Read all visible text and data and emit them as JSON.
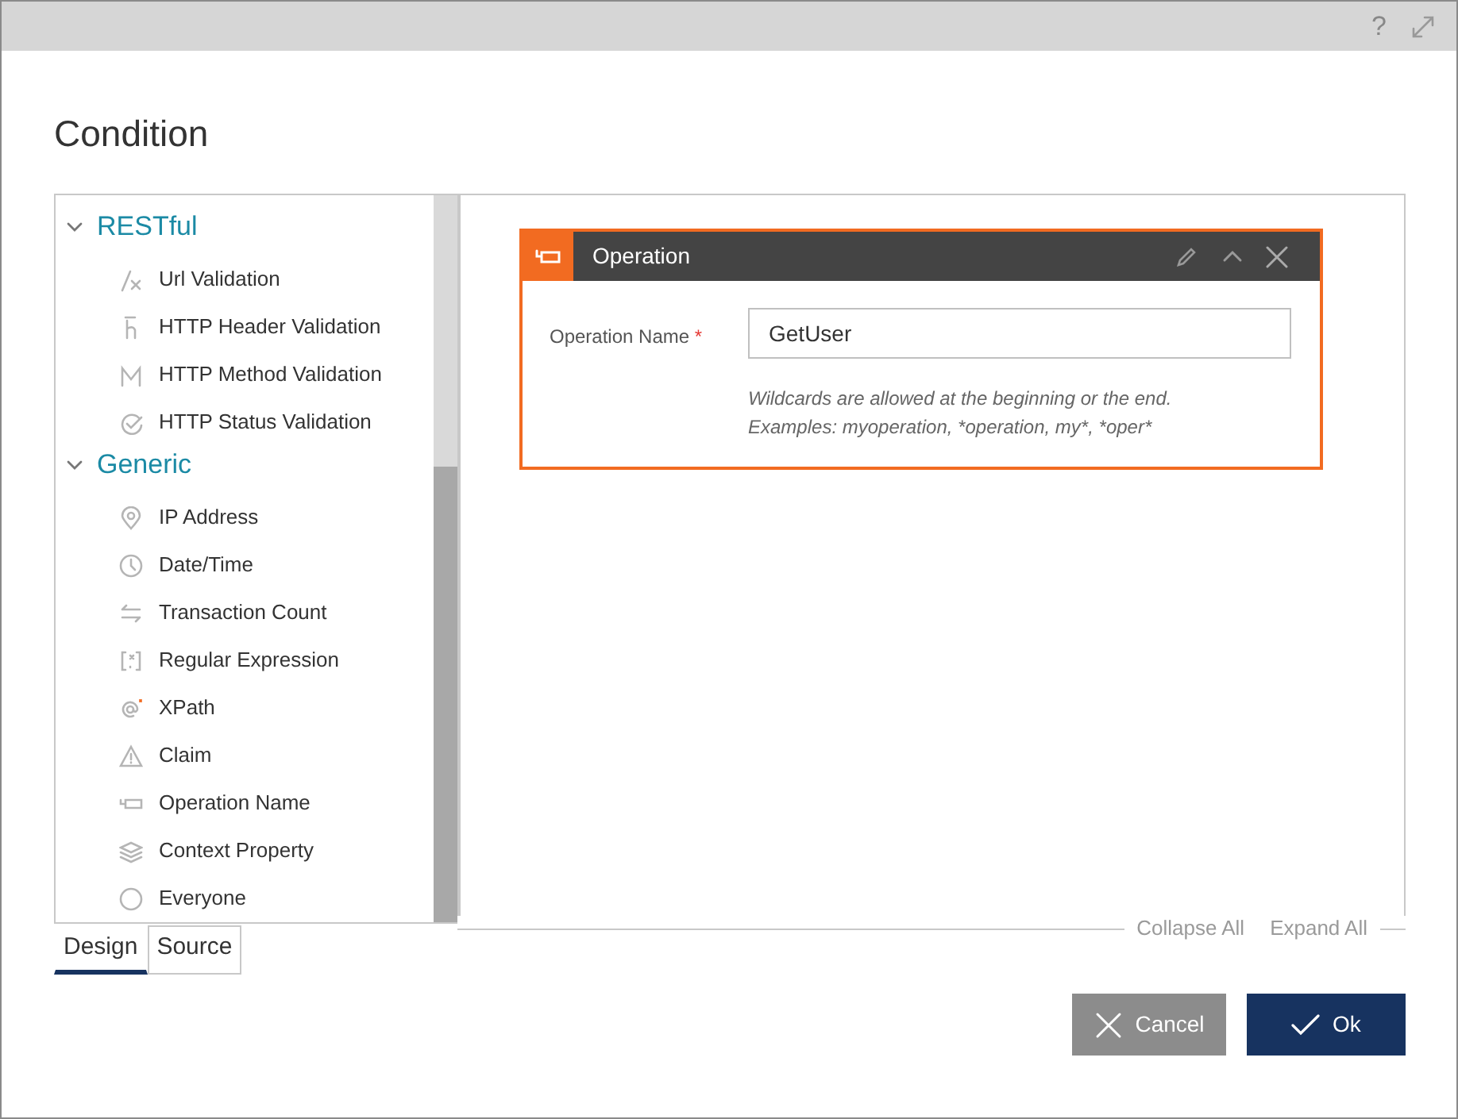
{
  "window": {
    "help": "?"
  },
  "title": "Condition",
  "tree": [
    {
      "label": "RESTful",
      "expanded": true,
      "children": [
        {
          "label": "Url Validation",
          "kind": "url"
        },
        {
          "label": "HTTP Header Validation",
          "kind": "header"
        },
        {
          "label": "HTTP Method Validation",
          "kind": "method"
        },
        {
          "label": "HTTP Status Validation",
          "kind": "status"
        }
      ]
    },
    {
      "label": "Generic",
      "expanded": true,
      "children": [
        {
          "label": "IP Address",
          "kind": "pin"
        },
        {
          "label": "Date/Time",
          "kind": "clock"
        },
        {
          "label": "Transaction Count",
          "kind": "arrows"
        },
        {
          "label": "Regular Expression",
          "kind": "regex"
        },
        {
          "label": "XPath",
          "kind": "xpath"
        },
        {
          "label": "Claim",
          "kind": "warning"
        },
        {
          "label": "Operation Name",
          "kind": "operation"
        },
        {
          "label": "Context Property",
          "kind": "layers"
        },
        {
          "label": "Everyone",
          "kind": "circle"
        }
      ]
    }
  ],
  "tabs": [
    {
      "label": "Design",
      "selected": true
    },
    {
      "label": "Source",
      "selected": false
    }
  ],
  "operation_panel": {
    "title": "Operation",
    "field_label": "Operation Name",
    "required_mark": "*",
    "value": "GetUser",
    "hint_lines": [
      "Wildcards are allowed at the beginning or the end.",
      "Examples: myoperation, *operation, my*, *oper*"
    ]
  },
  "canvas_links": [
    "Collapse All",
    "Expand All"
  ],
  "buttons": [
    {
      "label": "Cancel",
      "kind": "cancel"
    },
    {
      "label": "Ok",
      "kind": "ok"
    }
  ]
}
